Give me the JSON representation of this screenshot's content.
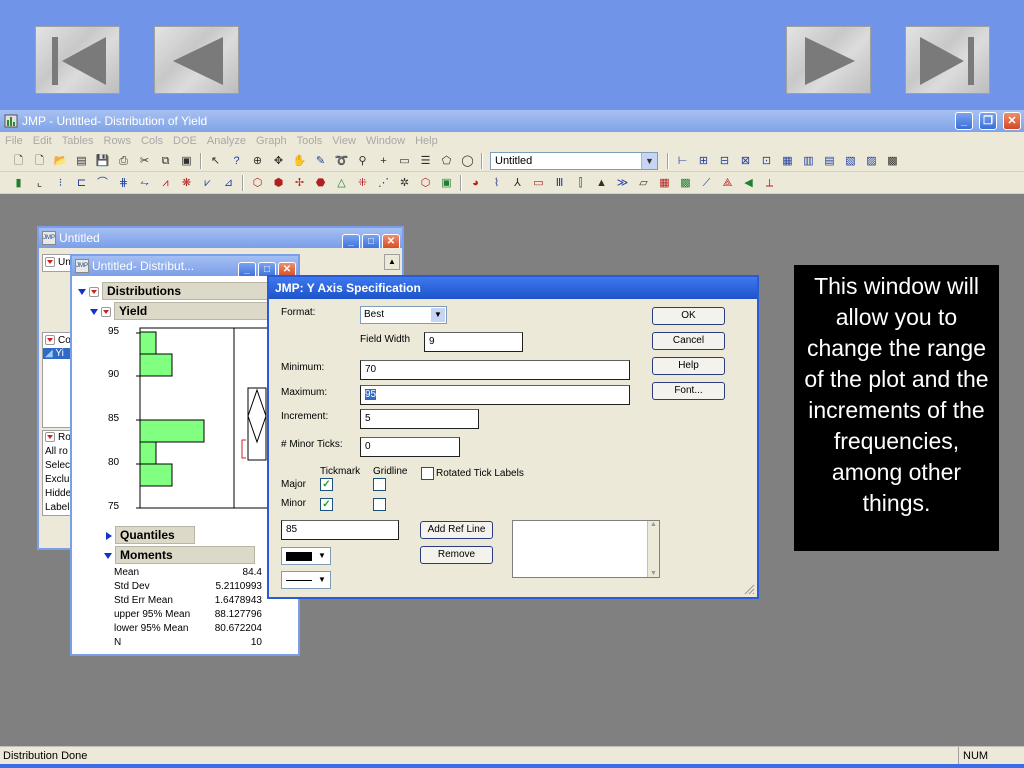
{
  "nav": {
    "first_icon": "skip-to-first-icon",
    "prev_icon": "previous-icon",
    "next_icon": "next-icon",
    "last_icon": "skip-to-last-icon"
  },
  "app": {
    "title": "JMP - Untitled- Distribution of Yield",
    "menu": [
      "File",
      "Edit",
      "Tables",
      "Rows",
      "Cols",
      "DOE",
      "Analyze",
      "Graph",
      "Tools",
      "View",
      "Window",
      "Help"
    ],
    "table_select": "Untitled",
    "status": "Distribution Done",
    "status_num": "NUM"
  },
  "table_window": {
    "title": "Untitled",
    "rows_panel": [
      "Un"
    ],
    "cols_label": "Co",
    "cols_item": "Yi",
    "rows_label": "Ro",
    "rows_items": [
      "All ro",
      "Selec",
      "Exclu",
      "Hidde",
      "Label"
    ]
  },
  "dist_window": {
    "title": "Untitled- Distribut...",
    "distributions_label": "Distributions",
    "yield_label": "Yield",
    "axis_ticks": [
      "95",
      "90",
      "85",
      "80",
      "75"
    ],
    "quantiles_label": "Quantiles",
    "moments_label": "Moments",
    "moments": [
      {
        "name": "Mean",
        "value": "84.4"
      },
      {
        "name": "Std Dev",
        "value": "5.2110993"
      },
      {
        "name": "Std Err Mean",
        "value": "1.6478943"
      },
      {
        "name": "upper 95% Mean",
        "value": "88.127796"
      },
      {
        "name": "lower 95% Mean",
        "value": "80.672204"
      },
      {
        "name": "N",
        "value": "10"
      }
    ]
  },
  "dialog": {
    "title": "JMP: Y Axis Specification",
    "format_label": "Format:",
    "format_value": "Best",
    "field_width_label": "Field Width",
    "field_width_value": "9",
    "minimum_label": "Minimum:",
    "minimum_value": "70",
    "maximum_label": "Maximum:",
    "maximum_value": "95",
    "increment_label": "Increment:",
    "increment_value": "5",
    "minor_ticks_label": "# Minor Ticks:",
    "minor_ticks_value": "0",
    "tickmark_label": "Tickmark",
    "gridline_label": "Gridline",
    "rotated_label": "Rotated Tick Labels",
    "major_label": "Major",
    "minor_label": "Minor",
    "ref_line_value": "85",
    "add_ref_line": "Add Ref Line",
    "remove": "Remove",
    "ok": "OK",
    "cancel": "Cancel",
    "help": "Help",
    "font": "Font..."
  },
  "callout": {
    "text": "This window will allow you to change the range of the plot and the increments of the frequencies, among other things."
  }
}
